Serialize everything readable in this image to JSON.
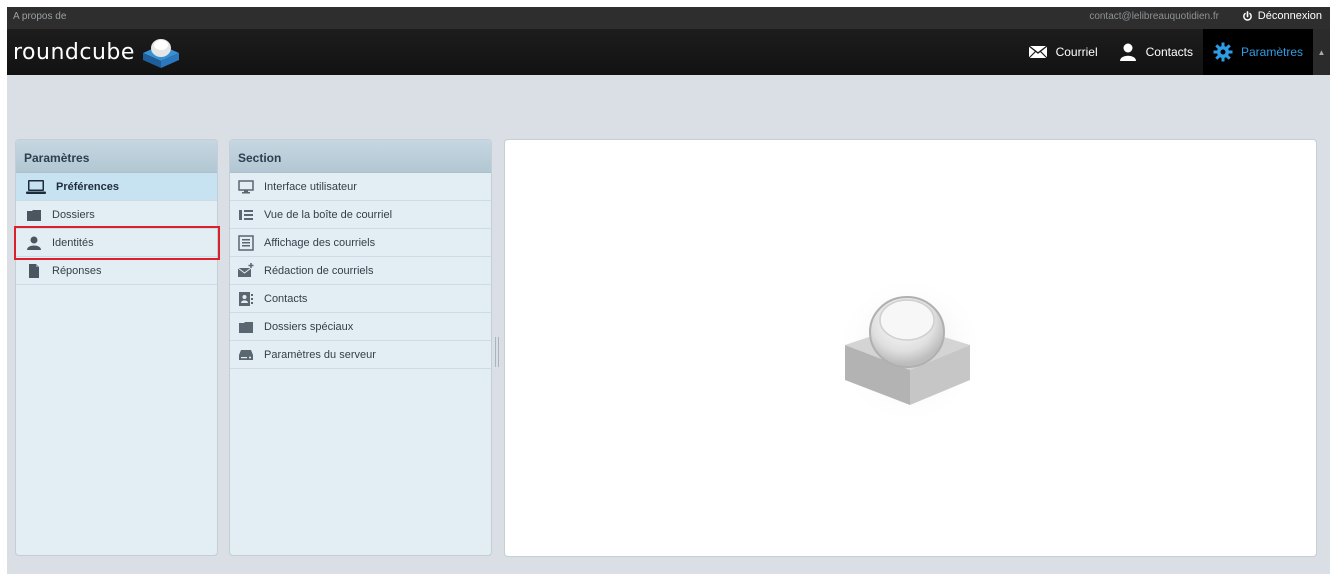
{
  "topline": {
    "about": "A propos de",
    "user": "contact@lelibreauquotidien.fr",
    "logout": "Déconnexion"
  },
  "header": {
    "logo": "roundcube",
    "tasks": [
      {
        "label": "Courriel",
        "icon": "mail-icon"
      },
      {
        "label": "Contacts",
        "icon": "person-icon"
      },
      {
        "label": "Paramètres",
        "icon": "gear-icon",
        "active": true
      }
    ]
  },
  "settings_panel": {
    "title": "Paramètres",
    "items": [
      {
        "label": "Préférences",
        "icon": "laptop-icon",
        "selected": true
      },
      {
        "label": "Dossiers",
        "icon": "folder-icon"
      },
      {
        "label": "Identités",
        "icon": "person-icon"
      },
      {
        "label": "Réponses",
        "icon": "document-icon"
      }
    ]
  },
  "section_panel": {
    "title": "Section",
    "items": [
      {
        "label": "Interface utilisateur",
        "icon": "monitor-icon"
      },
      {
        "label": "Vue de la boîte de courriel",
        "icon": "list-layout-icon"
      },
      {
        "label": "Affichage des courriels",
        "icon": "message-view-icon"
      },
      {
        "label": "Rédaction de courriels",
        "icon": "compose-icon"
      },
      {
        "label": "Contacts",
        "icon": "addressbook-icon"
      },
      {
        "label": "Dossiers spéciaux",
        "icon": "folder-icon"
      },
      {
        "label": "Paramètres du serveur",
        "icon": "server-icon"
      }
    ]
  },
  "colors": {
    "active_tab_text": "#2e9de6",
    "panel_bg": "#e3eef4",
    "highlight_box": "#d9202b"
  }
}
